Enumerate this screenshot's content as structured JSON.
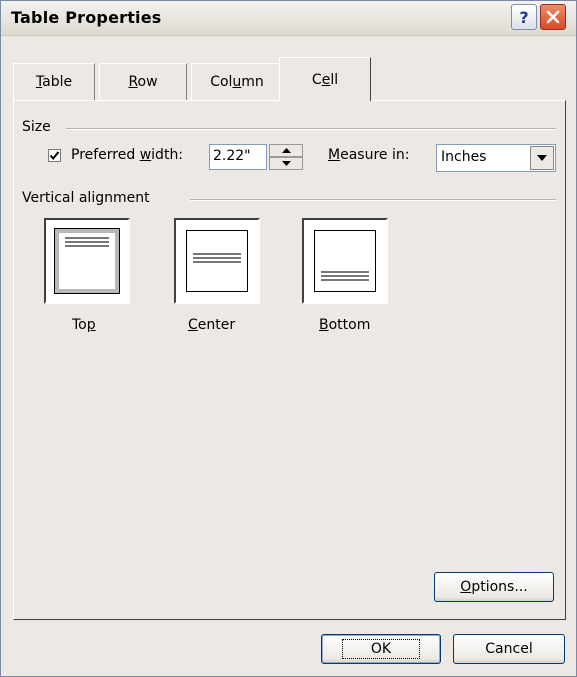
{
  "window": {
    "title": "Table Properties",
    "help_glyph": "?",
    "close_glyph": "✕"
  },
  "tabs": [
    {
      "label": "Table",
      "hotkey": "T",
      "rest": "able"
    },
    {
      "label": "Row",
      "hotkey": "R",
      "rest": "ow"
    },
    {
      "label": "Column",
      "pre": "Col",
      "hotkey": "u",
      "rest": "mn"
    },
    {
      "label": "Cell",
      "pre": "C",
      "hotkey": "e",
      "rest": "ll"
    }
  ],
  "size": {
    "group_label": "Size",
    "preferred_width": {
      "checked": true,
      "pre": "Preferred ",
      "hotkey": "w",
      "rest": "idth:",
      "value": "2.22\""
    },
    "measure_in": {
      "hotkey": "M",
      "rest": "easure in:",
      "value": "Inches"
    }
  },
  "vertical_alignment": {
    "group_label": "Vertical alignment",
    "options": [
      {
        "label": "Top",
        "pre": "To",
        "hotkey": "p",
        "rest": "",
        "selected": true
      },
      {
        "label": "Center",
        "pre": "",
        "hotkey": "C",
        "rest": "enter",
        "selected": false
      },
      {
        "label": "Bottom",
        "pre": "",
        "hotkey": "B",
        "rest": "ottom",
        "selected": false
      }
    ]
  },
  "buttons": {
    "options": {
      "hotkey": "O",
      "rest": "ptions..."
    },
    "ok": "OK",
    "cancel": "Cancel"
  }
}
